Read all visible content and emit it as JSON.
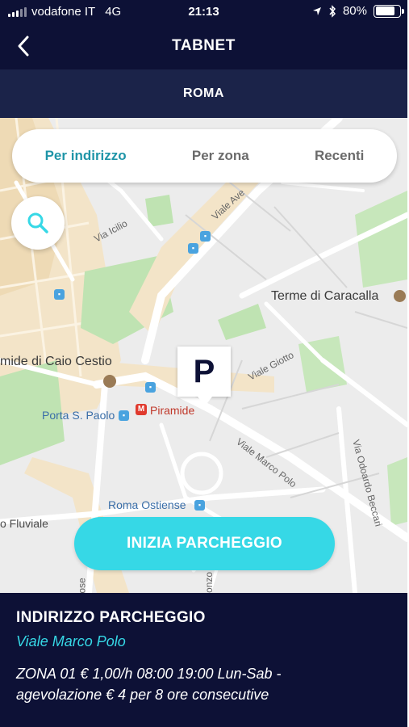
{
  "status_bar": {
    "carrier": "vodafone IT",
    "network": "4G",
    "time": "21:13",
    "battery": "80%",
    "battery_level": 0.8
  },
  "header": {
    "title": "TABNET",
    "city": "ROMA"
  },
  "tabs": [
    {
      "label": "Per indirizzo",
      "active": true
    },
    {
      "label": "Per zona",
      "active": false
    },
    {
      "label": "Recenti",
      "active": false
    }
  ],
  "map": {
    "labels": {
      "via_icilio": "Via Icilio",
      "viale_aventino": "Viale Ave",
      "terme": "Terme di Caracalla",
      "caio_cestio": "mide di Caio Cestio",
      "viale_giotto": "Viale Giotto",
      "porta_paolo": "Porta S. Paolo",
      "piramide": "Piramide",
      "viale_marco_polo": "Viale Marco Polo",
      "via_odoardo": "Via Odoardo Beccari",
      "roma_ostiense": "Roma Ostiense",
      "fluviale": "o Fluviale",
      "road_ose": "ose",
      "road_onzo": "onzo"
    },
    "parking_marker": "P",
    "metro_letter": "M"
  },
  "start_button": "INIZIA PARCHEGGIO",
  "info": {
    "heading": "INDIRIZZO PARCHEGGIO",
    "address": "Viale Marco Polo",
    "details": "ZONA 01 € 1,00/h 08:00 19:00 Lun-Sab - agevolazione € 4 per 8 ore consecutive"
  },
  "colors": {
    "navy": "#0d1136",
    "band": "#1b2349",
    "accent": "#36d8e6",
    "active_tab": "#1f95a8"
  }
}
